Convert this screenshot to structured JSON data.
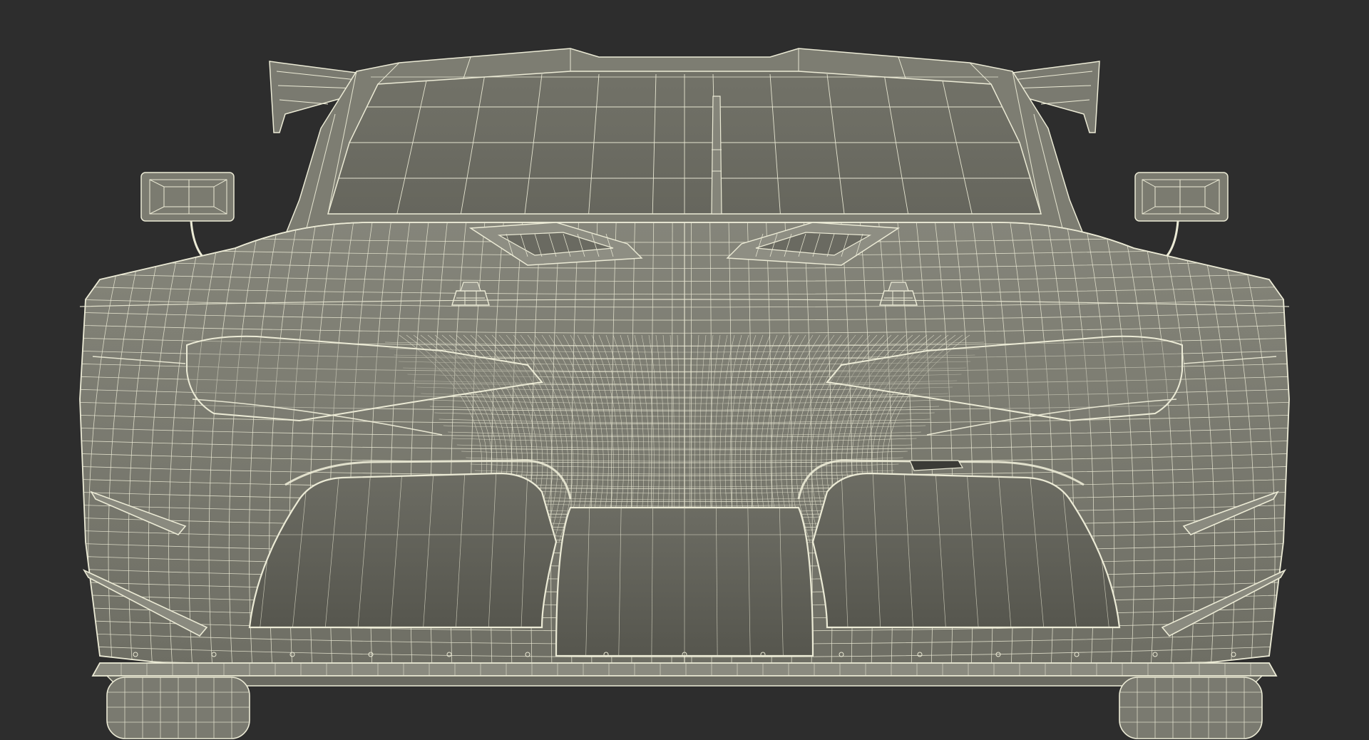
{
  "scene": {
    "subject": "race-car-front-wireframe",
    "colors": {
      "background": "#2d2d2d",
      "surface": "#7b7b70",
      "surface_dark": "#5f5f56",
      "surface_light": "#8c8c80",
      "wire": "#ecebd6",
      "shadow": "#55554d"
    }
  }
}
